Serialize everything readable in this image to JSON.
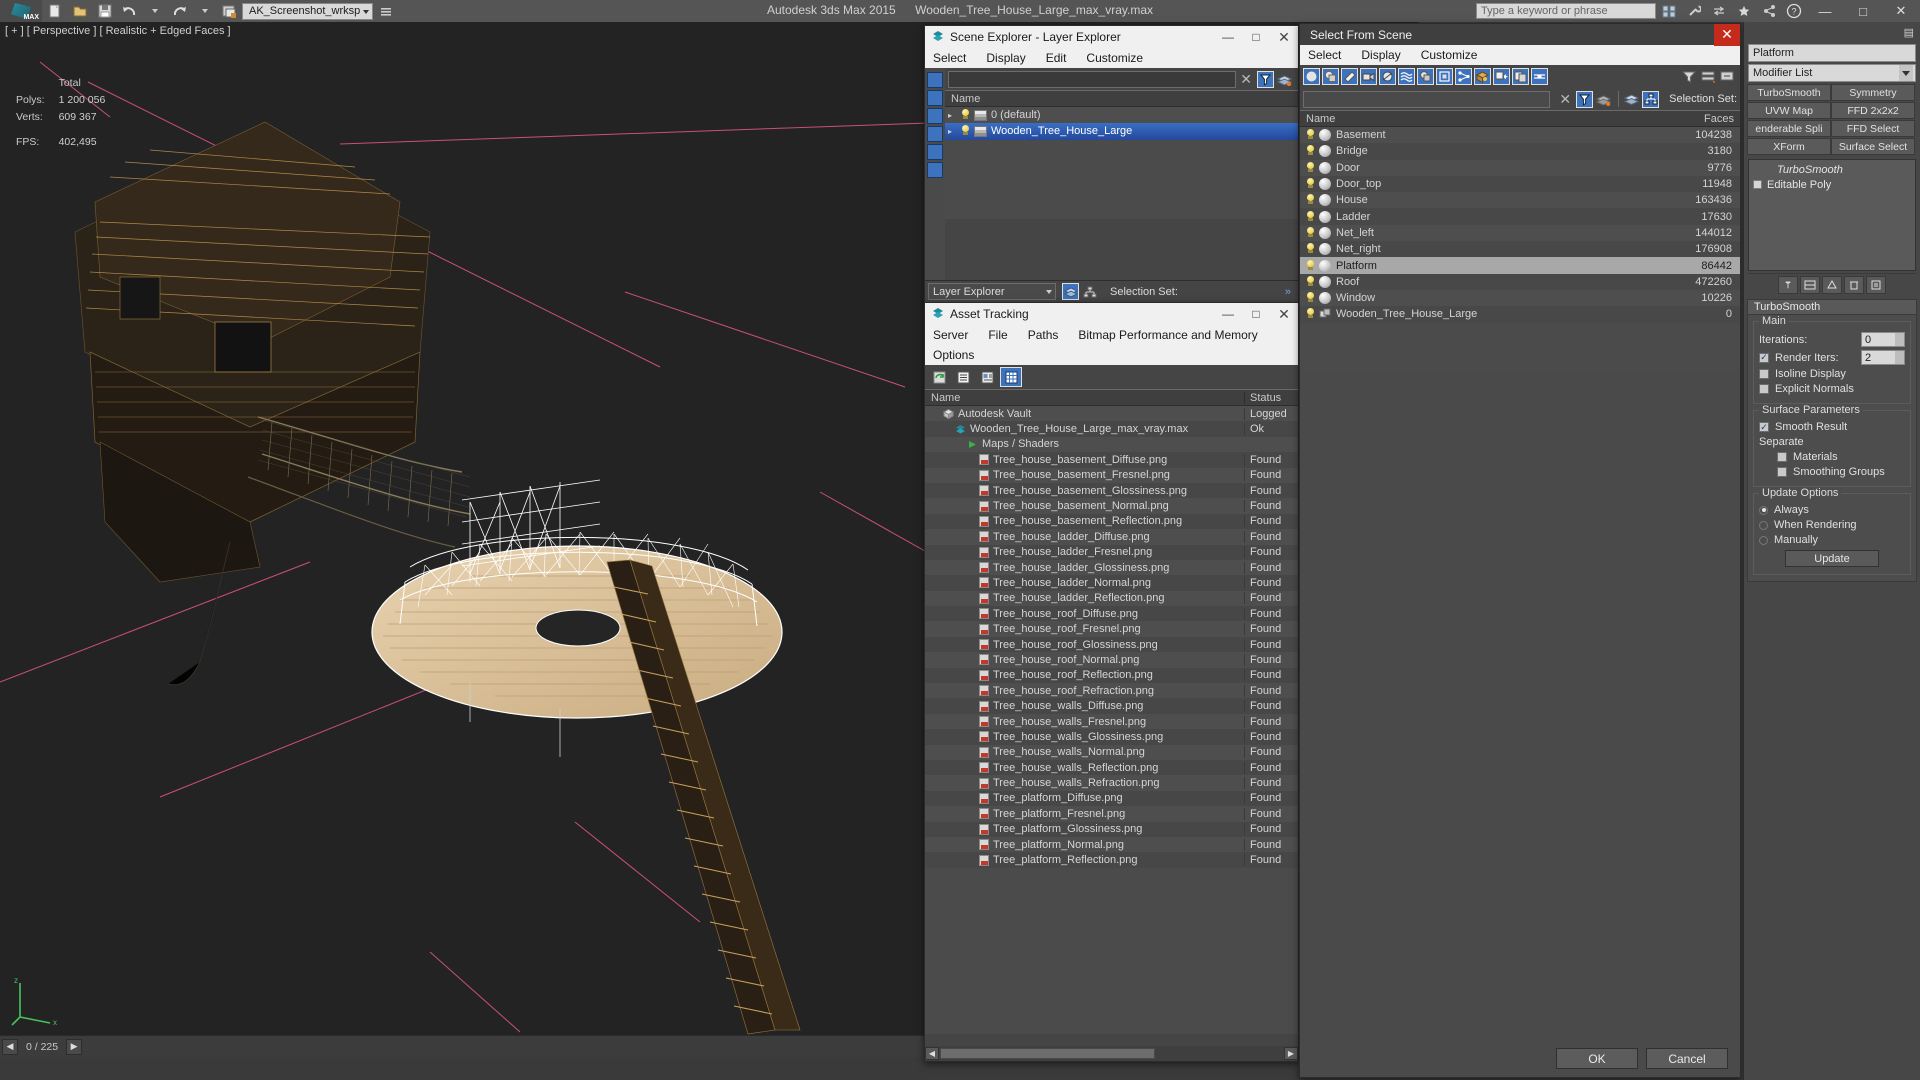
{
  "app": {
    "title_product": "Autodesk 3ds Max  2015",
    "title_file": "Wooden_Tree_House_Large_max_vray.max",
    "workspace": "AK_Screenshot_wrksp",
    "search_placeholder": "Type a keyword or phrase"
  },
  "viewport": {
    "label": "[ + ] [ Perspective ] [ Realistic + Edged Faces ]",
    "stats": {
      "total_label": "Total",
      "polys_label": "Polys:",
      "polys_value": "1 200 056",
      "verts_label": "Verts:",
      "verts_value": "609 367",
      "fps_label": "FPS:",
      "fps_value": "402,495"
    },
    "status_frame": "0 / 225"
  },
  "layer_explorer": {
    "title": "Scene Explorer - Layer Explorer",
    "menus": [
      "Select",
      "Display",
      "Edit",
      "Customize"
    ],
    "column_name": "Name",
    "rows": [
      {
        "name": "0 (default)",
        "selected": false,
        "expander": "▸"
      },
      {
        "name": "Wooden_Tree_House_Large",
        "selected": true,
        "expander": "▸"
      }
    ],
    "footer_combo": "Layer Explorer",
    "footer_selection_set": "Selection Set:"
  },
  "asset_tracking": {
    "title": "Asset Tracking",
    "menus": [
      "Server",
      "File",
      "Paths",
      "Bitmap Performance and Memory",
      "Options"
    ],
    "columns": {
      "name": "Name",
      "status": "Status"
    },
    "rows": [
      {
        "name": "Autodesk Vault",
        "status": "Logged",
        "indent": 1,
        "kind": "vault"
      },
      {
        "name": "Wooden_Tree_House_Large_max_vray.max",
        "status": "Ok",
        "indent": 2,
        "kind": "max"
      },
      {
        "name": "Maps / Shaders",
        "status": "",
        "indent": 3,
        "kind": "maps"
      },
      {
        "name": "Tree_house_basement_Diffuse.png",
        "status": "Found",
        "indent": 4,
        "kind": "png"
      },
      {
        "name": "Tree_house_basement_Fresnel.png",
        "status": "Found",
        "indent": 4,
        "kind": "png"
      },
      {
        "name": "Tree_house_basement_Glossiness.png",
        "status": "Found",
        "indent": 4,
        "kind": "png"
      },
      {
        "name": "Tree_house_basement_Normal.png",
        "status": "Found",
        "indent": 4,
        "kind": "png"
      },
      {
        "name": "Tree_house_basement_Reflection.png",
        "status": "Found",
        "indent": 4,
        "kind": "png"
      },
      {
        "name": "Tree_house_ladder_Diffuse.png",
        "status": "Found",
        "indent": 4,
        "kind": "png"
      },
      {
        "name": "Tree_house_ladder_Fresnel.png",
        "status": "Found",
        "indent": 4,
        "kind": "png"
      },
      {
        "name": "Tree_house_ladder_Glossiness.png",
        "status": "Found",
        "indent": 4,
        "kind": "png"
      },
      {
        "name": "Tree_house_ladder_Normal.png",
        "status": "Found",
        "indent": 4,
        "kind": "png"
      },
      {
        "name": "Tree_house_ladder_Reflection.png",
        "status": "Found",
        "indent": 4,
        "kind": "png"
      },
      {
        "name": "Tree_house_roof_Diffuse.png",
        "status": "Found",
        "indent": 4,
        "kind": "png"
      },
      {
        "name": "Tree_house_roof_Fresnel.png",
        "status": "Found",
        "indent": 4,
        "kind": "png"
      },
      {
        "name": "Tree_house_roof_Glossiness.png",
        "status": "Found",
        "indent": 4,
        "kind": "png"
      },
      {
        "name": "Tree_house_roof_Normal.png",
        "status": "Found",
        "indent": 4,
        "kind": "png"
      },
      {
        "name": "Tree_house_roof_Reflection.png",
        "status": "Found",
        "indent": 4,
        "kind": "png"
      },
      {
        "name": "Tree_house_roof_Refraction.png",
        "status": "Found",
        "indent": 4,
        "kind": "png"
      },
      {
        "name": "Tree_house_walls_Diffuse.png",
        "status": "Found",
        "indent": 4,
        "kind": "png"
      },
      {
        "name": "Tree_house_walls_Fresnel.png",
        "status": "Found",
        "indent": 4,
        "kind": "png"
      },
      {
        "name": "Tree_house_walls_Glossiness.png",
        "status": "Found",
        "indent": 4,
        "kind": "png"
      },
      {
        "name": "Tree_house_walls_Normal.png",
        "status": "Found",
        "indent": 4,
        "kind": "png"
      },
      {
        "name": "Tree_house_walls_Reflection.png",
        "status": "Found",
        "indent": 4,
        "kind": "png"
      },
      {
        "name": "Tree_house_walls_Refraction.png",
        "status": "Found",
        "indent": 4,
        "kind": "png"
      },
      {
        "name": "Tree_platform_Diffuse.png",
        "status": "Found",
        "indent": 4,
        "kind": "png"
      },
      {
        "name": "Tree_platform_Fresnel.png",
        "status": "Found",
        "indent": 4,
        "kind": "png"
      },
      {
        "name": "Tree_platform_Glossiness.png",
        "status": "Found",
        "indent": 4,
        "kind": "png"
      },
      {
        "name": "Tree_platform_Normal.png",
        "status": "Found",
        "indent": 4,
        "kind": "png"
      },
      {
        "name": "Tree_platform_Reflection.png",
        "status": "Found",
        "indent": 4,
        "kind": "png"
      }
    ]
  },
  "select_from_scene": {
    "title": "Select From Scene",
    "menus": [
      "Select",
      "Display",
      "Customize"
    ],
    "search_value": "",
    "selection_set_label": "Selection Set:",
    "columns": {
      "name": "Name",
      "faces": "Faces"
    },
    "rows": [
      {
        "name": "Basement",
        "faces": "104238",
        "selected": false
      },
      {
        "name": "Bridge",
        "faces": "3180",
        "selected": false
      },
      {
        "name": "Door",
        "faces": "9776",
        "selected": false
      },
      {
        "name": "Door_top",
        "faces": "11948",
        "selected": false
      },
      {
        "name": "House",
        "faces": "163436",
        "selected": false
      },
      {
        "name": "Ladder",
        "faces": "17630",
        "selected": false
      },
      {
        "name": "Net_left",
        "faces": "144012",
        "selected": false
      },
      {
        "name": "Net_right",
        "faces": "176908",
        "selected": false
      },
      {
        "name": "Platform",
        "faces": "86442",
        "selected": true
      },
      {
        "name": "Roof",
        "faces": "472260",
        "selected": false
      },
      {
        "name": "Window",
        "faces": "10226",
        "selected": false
      },
      {
        "name": "Wooden_Tree_House_Large",
        "faces": "0",
        "selected": false,
        "group": true
      }
    ],
    "ok_label": "OK",
    "cancel_label": "Cancel"
  },
  "command_panel": {
    "object_name": "Platform",
    "modifier_list_label": "Modifier List",
    "modifier_buttons": [
      "TurboSmooth",
      "Symmetry",
      "UVW Map",
      "FFD 2x2x2",
      "enderable Spli",
      "FFD Select",
      "XForm",
      "Surface Select"
    ],
    "stack": [
      {
        "label": "TurboSmooth",
        "italic": true,
        "checkbox": false
      },
      {
        "label": "Editable Poly",
        "italic": false,
        "checkbox": true
      }
    ],
    "rollup_title": "TurboSmooth",
    "groups": {
      "main": {
        "label": "Main",
        "iterations_label": "Iterations:",
        "iterations_value": "0",
        "render_iters_label": "Render Iters:",
        "render_iters_value": "2",
        "render_iters_checked": true,
        "isoline_label": "Isoline Display",
        "isoline_checked": false,
        "explicit_label": "Explicit Normals",
        "explicit_checked": false
      },
      "surface": {
        "label": "Surface Parameters",
        "smooth_label": "Smooth Result",
        "smooth_checked": true,
        "separate_label": "Separate",
        "materials_label": "Materials",
        "materials_checked": false,
        "smoothing_label": "Smoothing Groups",
        "smoothing_checked": false
      },
      "update": {
        "label": "Update Options",
        "options": [
          "Always",
          "When Rendering",
          "Manually"
        ],
        "selected": "Always",
        "button": "Update"
      }
    }
  }
}
